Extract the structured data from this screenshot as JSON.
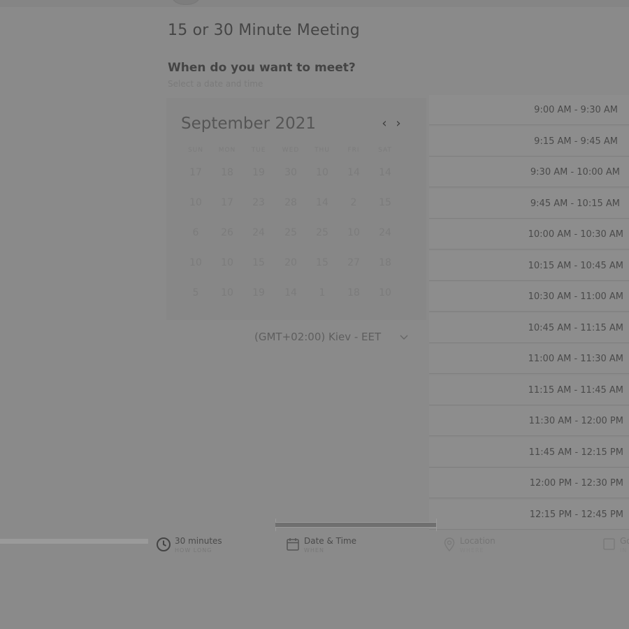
{
  "page": {
    "title": "15 or 30 Minute Meeting",
    "question": "When do you want to meet?",
    "instruction": "Select a date and time"
  },
  "calendar": {
    "month_label": "September 2021",
    "prev_icon": "chevron-left-icon",
    "next_icon": "chevron-right-icon",
    "weekdays": [
      "SUN",
      "MON",
      "TUE",
      "WED",
      "THU",
      "FRI",
      "SAT"
    ],
    "weeks": [
      [
        "17",
        "18",
        "19",
        "30",
        "10",
        "14",
        "14"
      ],
      [
        "10",
        "17",
        "23",
        "28",
        "14",
        "2",
        "15"
      ],
      [
        "6",
        "26",
        "24",
        "25",
        "25",
        "10",
        "24"
      ],
      [
        "10",
        "10",
        "15",
        "20",
        "15",
        "27",
        "18"
      ],
      [
        "5",
        "10",
        "19",
        "14",
        "1",
        "18",
        "10"
      ]
    ]
  },
  "timezone": {
    "label": "(GMT+02:00) Kiev - EET",
    "icon": "chevron-down-icon"
  },
  "time_slots": [
    "9:00 AM - 9:30 AM",
    "9:15 AM - 9:45 AM",
    "9:30 AM - 10:00 AM",
    "9:45 AM - 10:15 AM",
    "10:00 AM - 10:30 AM",
    "10:15 AM - 10:45 AM",
    "10:30 AM - 11:00 AM",
    "10:45 AM - 11:15 AM",
    "11:00 AM - 11:30 AM",
    "11:15 AM - 11:45 AM",
    "11:30 AM - 12:00 PM",
    "11:45 AM - 12:15 PM",
    "12:00 PM - 12:30 PM",
    "12:15 PM - 12:45 PM"
  ],
  "steps": [
    {
      "title": "30 minutes",
      "sub": "HOW LONG",
      "icon": "clock-icon"
    },
    {
      "title": "Date & Time",
      "sub": "WHEN",
      "icon": "calendar-icon"
    },
    {
      "title": "Location",
      "sub": "WHERE",
      "icon": "location-pin-icon"
    },
    {
      "title": "Go",
      "sub": "IN",
      "icon": "checkbox-icon"
    }
  ],
  "colors": {
    "background": "#8a8a8a",
    "text_dark": "#444444",
    "text_muted": "#7b7b7b"
  }
}
